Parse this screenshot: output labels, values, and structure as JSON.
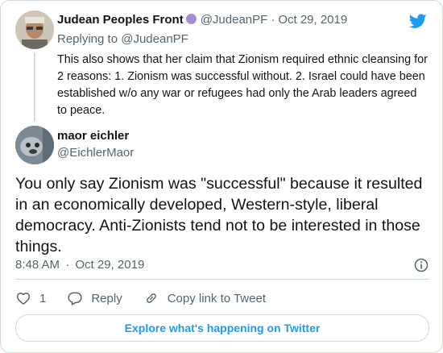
{
  "parent_tweet": {
    "name": "Judean Peoples Front",
    "handle": "@JudeanPF",
    "separator": "·",
    "date": "Oct 29, 2019",
    "replying_to_prefix": "Replying to ",
    "replying_to_handle": "@JudeanPF",
    "text": "This also shows that her claim that Zionism required ethnic cleansing for 2 reasons: 1. Zionism was successful without. 2. Israel could have been established w/o any war or refugees had only the Arab leaders agreed to peace."
  },
  "main_tweet": {
    "name": "maor eichler",
    "handle": "@EichlerMaor",
    "text": "You only say Zionism was \"successful\" because it resulted in an economically developed, Western-style, liberal democracy. Anti-Zionists tend not to be interested in those things.",
    "time": "8:48 AM",
    "separator": "·",
    "date": "Oct 29, 2019"
  },
  "actions": {
    "like_count": "1",
    "reply_label": "Reply",
    "copy_link_label": "Copy link to Tweet"
  },
  "explore_button_label": "Explore what's happening on Twitter",
  "colors": {
    "accent": "#1d9bf0",
    "secondary_text": "#536471",
    "border": "#cfd9de",
    "badge": "#a78bd4"
  },
  "icons": {
    "logo": "twitter-bird-icon",
    "info": "info-icon",
    "like": "heart-icon",
    "reply": "reply-bubble-icon",
    "copy": "link-icon"
  }
}
